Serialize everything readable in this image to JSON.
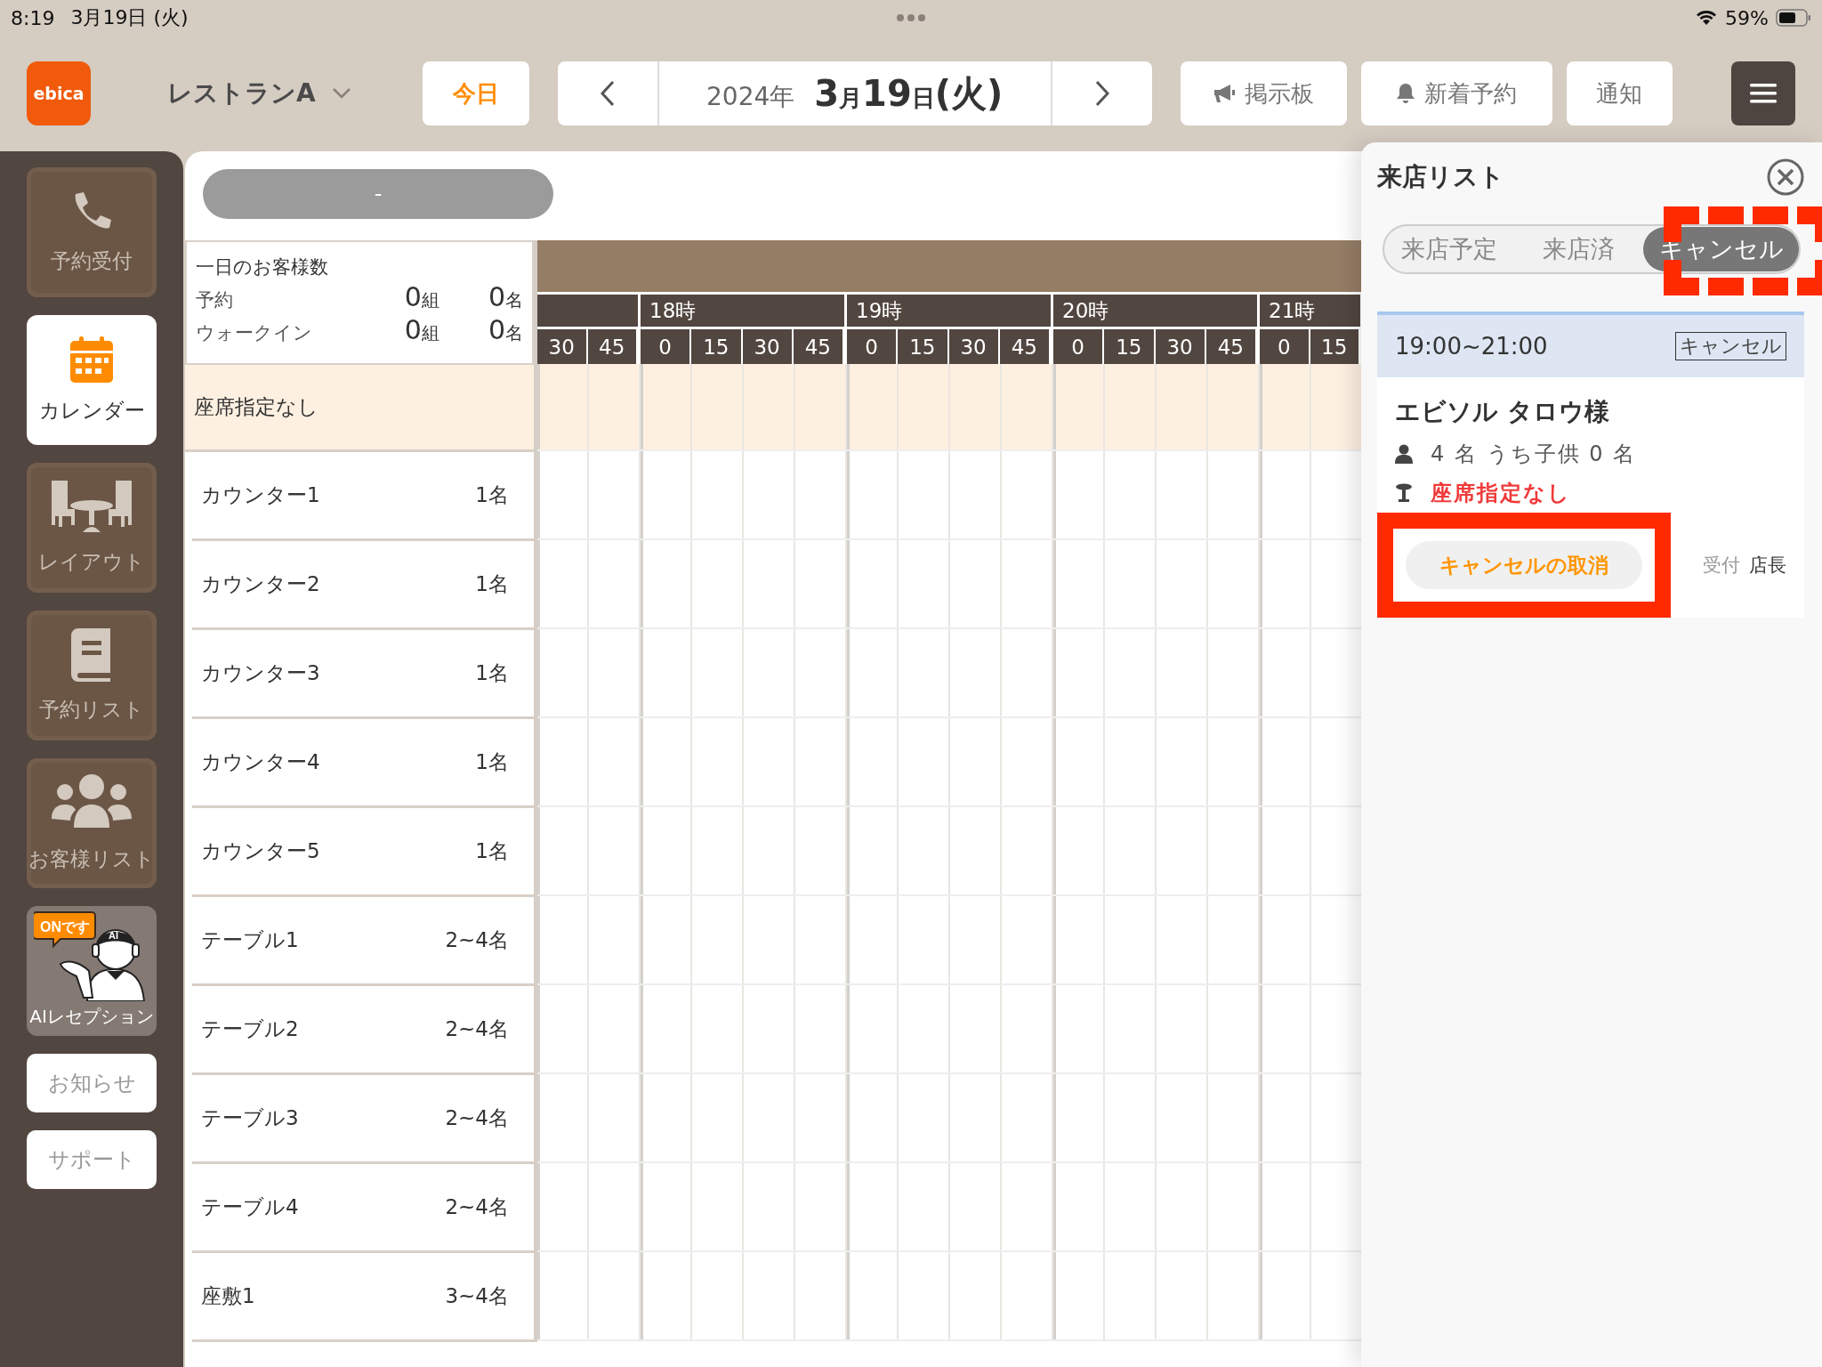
{
  "status_bar": {
    "time": "8:19",
    "date": "3月19日 (火)",
    "battery": "59%"
  },
  "header": {
    "logo": "ebica",
    "store": "レストランA",
    "today": "今日",
    "date": {
      "year": "2024年",
      "month": "3",
      "month_unit": "月",
      "day": "19",
      "day_unit": "日",
      "weekday": "(火)"
    },
    "buttons": [
      {
        "label": "掲示板",
        "kind": "board"
      },
      {
        "label": "新着予約",
        "kind": "bell"
      },
      {
        "label": "通知",
        "kind": "plain"
      }
    ]
  },
  "sidebar": {
    "items": [
      {
        "label": "予約受付",
        "kind": "tile",
        "selected": false
      },
      {
        "label": "カレンダー",
        "kind": "tile",
        "selected": true
      },
      {
        "label": "レイアウト",
        "kind": "tile",
        "selected": false
      },
      {
        "label": "予約リスト",
        "kind": "tile",
        "selected": false
      },
      {
        "label": "お客様リスト",
        "kind": "tile",
        "selected": false
      },
      {
        "label": "AIレセプション",
        "kind": "ai",
        "badge": "ONです",
        "hat": "AI",
        "selected": false
      },
      {
        "label": "お知らせ",
        "kind": "button",
        "selected": false
      },
      {
        "label": "サポート",
        "kind": "button",
        "selected": false
      }
    ]
  },
  "filter": {
    "label": "-"
  },
  "summary": {
    "title": "一日のお客様数",
    "rows": [
      {
        "label": "予約",
        "groups": "0",
        "groups_unit": "組",
        "people": "0",
        "people_unit": "名"
      },
      {
        "label": "ウォークイン",
        "groups": "0",
        "groups_unit": "組",
        "people": "0",
        "people_unit": "名"
      }
    ]
  },
  "timeline": {
    "hours": [
      {
        "minutes": [
          "30",
          "45"
        ]
      },
      {
        "label": "18時",
        "minutes": [
          "0",
          "15",
          "30",
          "45"
        ]
      },
      {
        "label": "19時",
        "minutes": [
          "0",
          "15",
          "30",
          "45"
        ]
      },
      {
        "label": "20時",
        "minutes": [
          "0",
          "15",
          "30",
          "45"
        ]
      },
      {
        "label": "21時",
        "minutes": [
          "0",
          "15"
        ]
      }
    ]
  },
  "seats": [
    {
      "name": "座席指定なし",
      "kind": "unassigned"
    },
    {
      "name": "カウンター1",
      "capacity": "1名",
      "kind": "seat"
    },
    {
      "name": "カウンター2",
      "capacity": "1名",
      "kind": "seat"
    },
    {
      "name": "カウンター3",
      "capacity": "1名",
      "kind": "seat"
    },
    {
      "name": "カウンター4",
      "capacity": "1名",
      "kind": "seat"
    },
    {
      "name": "カウンター5",
      "capacity": "1名",
      "kind": "seat"
    },
    {
      "name": "テーブル1",
      "capacity": "2~4名",
      "kind": "seat"
    },
    {
      "name": "テーブル2",
      "capacity": "2~4名",
      "kind": "seat"
    },
    {
      "name": "テーブル3",
      "capacity": "2~4名",
      "kind": "seat"
    },
    {
      "name": "テーブル4",
      "capacity": "2~4名",
      "kind": "seat"
    },
    {
      "name": "座敷1",
      "capacity": "3~4名",
      "kind": "seat"
    }
  ],
  "visit_panel": {
    "title": "来店リスト",
    "tabs": [
      {
        "label": "来店予定",
        "selected": false
      },
      {
        "label": "来店済",
        "selected": false
      },
      {
        "label": "キャンセル",
        "selected": true,
        "highlighted": true
      }
    ],
    "card": {
      "time": "19:00~21:00",
      "status": "キャンセル",
      "name": "エビソル タロウ様",
      "party": "4 名 うち子供 0 名",
      "seat": "座席指定なし",
      "action": "キャンセルの取消",
      "action_highlighted": true,
      "received_label": "受付",
      "received_by": "店長"
    }
  }
}
